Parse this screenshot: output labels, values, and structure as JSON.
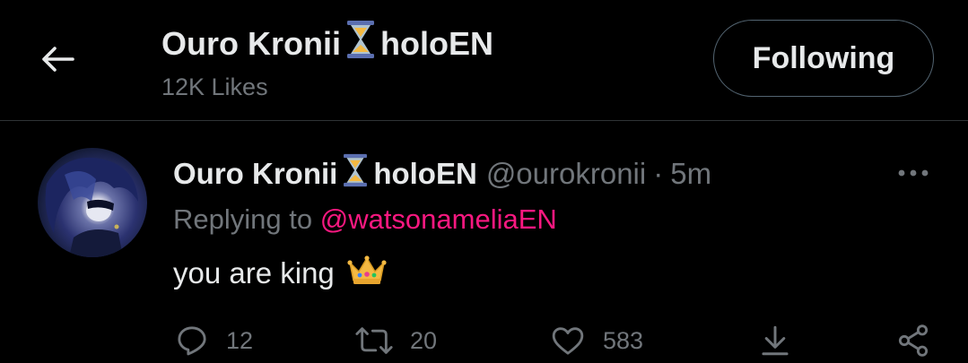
{
  "header": {
    "name": "Ouro Kronii",
    "name_suffix": "holoEN",
    "likes": "12K Likes",
    "follow_label": "Following"
  },
  "tweet": {
    "display_name": "Ouro Kronii",
    "display_suffix": "holoEN",
    "handle": "@ourokronii",
    "separator": "·",
    "time": "5m",
    "replying_prefix": "Replying to",
    "replying_to": "@watsonameliaEN",
    "text": "you are king",
    "reply_count": "12",
    "retweet_count": "20",
    "like_count": "583"
  },
  "icons": {
    "back": "arrow-left-icon",
    "name_emoji": "hourglass-icon",
    "text_emoji": "crown-icon",
    "more": "more-horizontal-icon",
    "reply": "reply-icon",
    "retweet": "retweet-icon",
    "like": "heart-icon",
    "download": "download-icon",
    "share": "share-icon"
  },
  "colors": {
    "background": "#000000",
    "text": "#e7e9ea",
    "secondary": "#71767b",
    "mention": "#f91880",
    "border": "#2f3336"
  }
}
